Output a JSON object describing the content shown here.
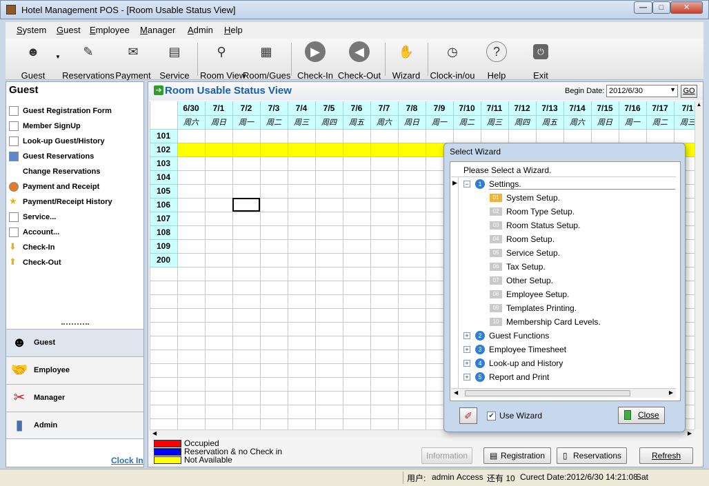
{
  "window": {
    "title": "Hotel Management POS - [Room Usable Status View]"
  },
  "menu": [
    "System",
    "Guest",
    "Employee",
    "Manager",
    "Admin",
    "Help"
  ],
  "toolbar": [
    {
      "label": "Guest",
      "icon": "guest-icon"
    },
    {
      "label": "Reservations",
      "icon": "reservations-icon"
    },
    {
      "label": "Payment",
      "icon": "payment-icon"
    },
    {
      "label": "Service",
      "icon": "service-icon"
    },
    {
      "label": "Room View",
      "icon": "room-view-icon"
    },
    {
      "label": "Room/Gues",
      "icon": "room-guest-icon"
    },
    {
      "label": "Check-In",
      "icon": "check-in-icon"
    },
    {
      "label": "Check-Out",
      "icon": "check-out-icon"
    },
    {
      "label": "Wizard",
      "icon": "wizard-icon"
    },
    {
      "label": "Clock-in/ou",
      "icon": "clock-icon"
    },
    {
      "label": "Help",
      "icon": "help-icon"
    },
    {
      "label": "Exit",
      "icon": "exit-icon"
    }
  ],
  "sidebar": {
    "title": "Guest",
    "items": [
      {
        "label": "Guest Registration Form",
        "icon": "registration-form-icon"
      },
      {
        "label": "Member SignUp",
        "icon": "document-icon"
      },
      {
        "label": "Look-up Guest/History",
        "icon": "lookup-icon"
      },
      {
        "label": "Guest Reservations",
        "icon": "reservations-icon"
      },
      {
        "label": "Change Reservations",
        "icon": ""
      },
      {
        "label": "Payment and Receipt",
        "icon": "person-icon"
      },
      {
        "label": "Payment/Receipt History",
        "icon": "star-icon"
      },
      {
        "label": "Service...",
        "icon": "document-icon"
      },
      {
        "label": "Account...",
        "icon": "document-icon"
      },
      {
        "label": "Check-In",
        "icon": "arrow-down-icon"
      },
      {
        "label": "Check-Out",
        "icon": "arrow-up-icon"
      }
    ],
    "sections": [
      {
        "label": "Guest",
        "icon": "guest-icon",
        "active": true
      },
      {
        "label": "Employee",
        "icon": "employee-icon",
        "active": false
      },
      {
        "label": "Manager",
        "icon": "manager-icon",
        "active": false
      },
      {
        "label": "Admin",
        "icon": "admin-icon",
        "active": false
      }
    ],
    "clock_in": "Clock In"
  },
  "main": {
    "title": "Room Usable Status View",
    "begin_date_label": "Begin Date:",
    "begin_date_value": "2012/6/30",
    "go_label": "GO",
    "dates": [
      "6/30",
      "7/1",
      "7/2",
      "7/3",
      "7/4",
      "7/5",
      "7/6",
      "7/7",
      "7/8",
      "7/9",
      "7/10",
      "7/11",
      "7/12",
      "7/13",
      "7/14",
      "7/15",
      "7/16",
      "7/17",
      "7/1"
    ],
    "weekdays": [
      "周六",
      "周日",
      "周一",
      "周二",
      "周三",
      "周四",
      "周五",
      "周六",
      "周日",
      "周一",
      "周二",
      "周三",
      "周四",
      "周五",
      "周六",
      "周日",
      "周一",
      "周二",
      "周三"
    ],
    "rooms": [
      "101",
      "102",
      "103",
      "104",
      "105",
      "106",
      "107",
      "108",
      "109",
      "200"
    ],
    "not_available_room": "102",
    "colors": {
      "occupied": "#ff0000",
      "reservation": "#0000ff",
      "not_available": "#ffff00",
      "header_bg": "#ccffff"
    },
    "legend": [
      {
        "label": "Occupied",
        "color": "#ff0000"
      },
      {
        "label": "Reservation & no Check in",
        "color": "#0000ff"
      },
      {
        "label": "Not Available",
        "color": "#ffff00"
      }
    ],
    "buttons": {
      "information": "Information",
      "registration": "Registration",
      "reservations": "Reservations",
      "refresh": "Refresh"
    }
  },
  "dialog": {
    "title": "Select Wizard",
    "header": "Please Select a Wizard.",
    "groups": [
      {
        "num": "1",
        "label": "Settings.",
        "expanded": true
      },
      {
        "num": "2",
        "label": "Guest Functions",
        "expanded": false
      },
      {
        "num": "3",
        "label": "Employee Timesheet",
        "expanded": false
      },
      {
        "num": "4",
        "label": "Look-up and History",
        "expanded": false
      },
      {
        "num": "5",
        "label": "Report and Print",
        "expanded": false
      }
    ],
    "settings_items": [
      {
        "num": "01",
        "label": "System Setup."
      },
      {
        "num": "02",
        "label": "Room Type Setup."
      },
      {
        "num": "03",
        "label": "Room Status Setup."
      },
      {
        "num": "04",
        "label": "Room Setup."
      },
      {
        "num": "05",
        "label": "Service Setup."
      },
      {
        "num": "06",
        "label": "Tax Setup."
      },
      {
        "num": "07",
        "label": "Other Setup."
      },
      {
        "num": "08",
        "label": "Employee Setup."
      },
      {
        "num": "09",
        "label": "Templates Printing."
      },
      {
        "num": "10",
        "label": "Membership Card Levels."
      }
    ],
    "use_wizard_label": "Use Wizard",
    "use_wizard_checked": true,
    "close_label": "Close"
  },
  "status": {
    "user_label": "用户:",
    "user": "admin",
    "access": "Access",
    "remaining": "还有 10",
    "current_date": "Curect Date:2012/6/30 14:21:08",
    "day": "Sat"
  }
}
